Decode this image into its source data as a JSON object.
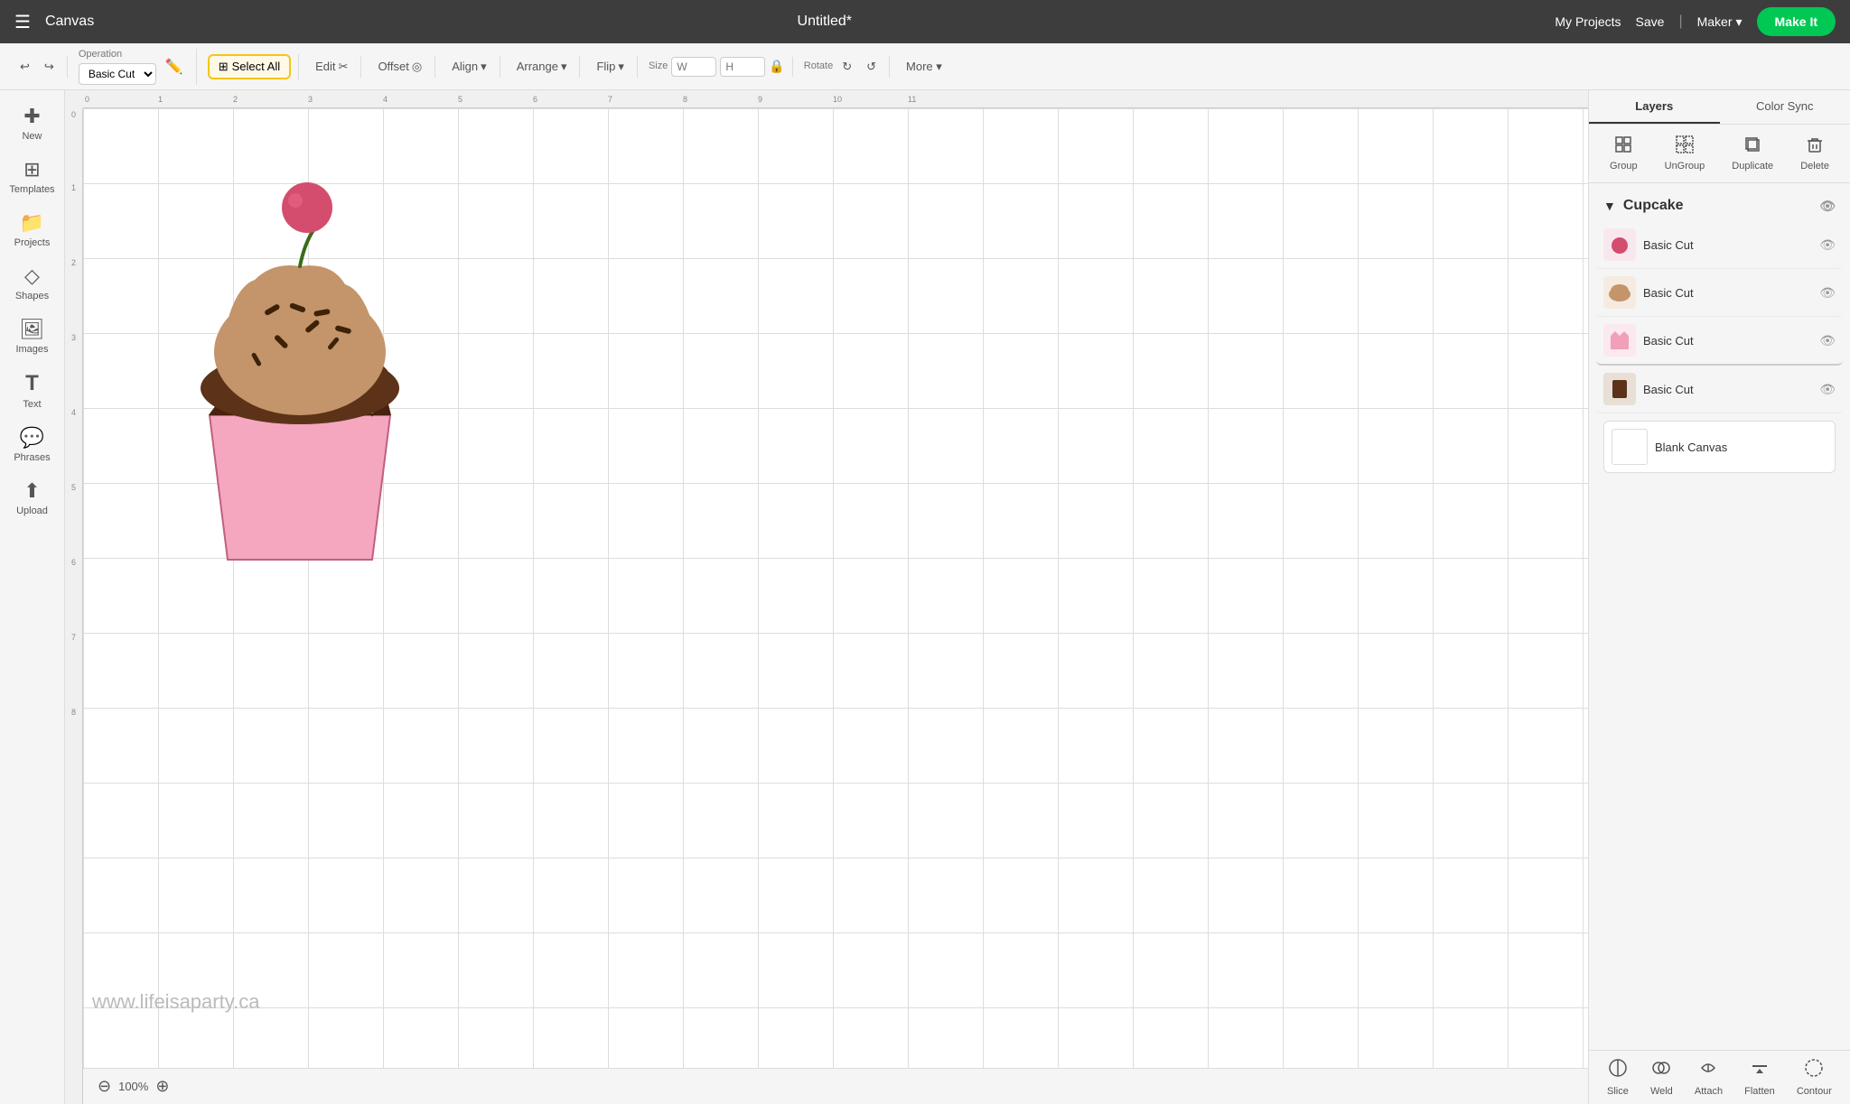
{
  "topbar": {
    "menu_icon": "☰",
    "app_name": "Canvas",
    "title": "Untitled*",
    "my_projects_label": "My Projects",
    "save_label": "Save",
    "divider": "|",
    "maker_label": "Maker",
    "make_it_label": "Make It"
  },
  "toolbar": {
    "undo_icon": "↩",
    "redo_icon": "↪",
    "operation_label": "Operation",
    "operation_value": "Basic Cut",
    "edit_label": "Edit",
    "offset_label": "Offset",
    "align_label": "Align",
    "arrange_label": "Arrange",
    "flip_label": "Flip",
    "size_label": "Size",
    "size_w_placeholder": "W",
    "size_h_placeholder": "H",
    "lock_icon": "🔒",
    "rotate_label": "Rotate",
    "more_label": "More ▾",
    "select_all_label": "Select All",
    "select_all_icon": "⊞"
  },
  "left_sidebar": {
    "items": [
      {
        "id": "new",
        "icon": "✚",
        "label": "New"
      },
      {
        "id": "templates",
        "icon": "⊞",
        "label": "Templates"
      },
      {
        "id": "projects",
        "icon": "📁",
        "label": "Projects"
      },
      {
        "id": "shapes",
        "icon": "◇",
        "label": "Shapes"
      },
      {
        "id": "images",
        "icon": "🖼",
        "label": "Images"
      },
      {
        "id": "text",
        "icon": "T",
        "label": "Text"
      },
      {
        "id": "phrases",
        "icon": "💬",
        "label": "Phrases"
      },
      {
        "id": "upload",
        "icon": "⬆",
        "label": "Upload"
      }
    ]
  },
  "canvas": {
    "zoom_value": "100%",
    "watermark": "www.lifeisaparty.ca",
    "ruler_marks_top": [
      "0",
      "1",
      "2",
      "3",
      "4",
      "5",
      "6",
      "7",
      "8",
      "9",
      "10",
      "11"
    ],
    "ruler_marks_left": [
      "0",
      "1",
      "2",
      "3",
      "4",
      "5",
      "6",
      "7",
      "8"
    ]
  },
  "right_panel": {
    "tabs": [
      {
        "id": "layers",
        "label": "Layers",
        "active": true
      },
      {
        "id": "color_sync",
        "label": "Color Sync",
        "active": false
      }
    ],
    "toolbar": {
      "group_label": "Group",
      "ungroup_label": "UnGroup",
      "duplicate_label": "Duplicate",
      "delete_label": "Delete"
    },
    "layers_title": "Cupcake",
    "layers": [
      {
        "id": "layer1",
        "label": "Basic Cut",
        "thumb_color": "#d44d6e",
        "thumb_type": "heart"
      },
      {
        "id": "layer2",
        "label": "Basic Cut",
        "thumb_color": "#c4956a",
        "thumb_type": "frosting"
      },
      {
        "id": "layer3",
        "label": "Basic Cut",
        "thumb_color": "#f0a0b8",
        "thumb_type": "wrapper_top"
      },
      {
        "id": "layer4",
        "label": "Basic Cut",
        "thumb_color": "#5c3d1e",
        "thumb_type": "cup"
      }
    ],
    "blank_canvas_label": "Blank Canvas",
    "bottom_bar": {
      "slice_label": "Slice",
      "weld_label": "Weld",
      "attach_label": "Attach",
      "flatten_label": "Flatten",
      "contour_label": "Contour"
    }
  }
}
